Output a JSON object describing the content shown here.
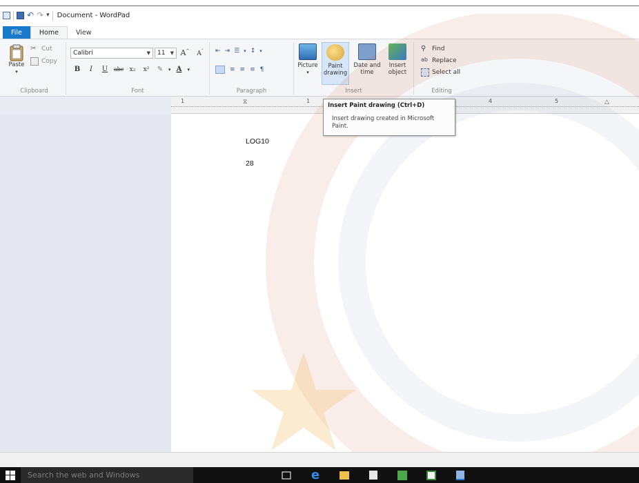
{
  "window": {
    "title": "Document - WordPad"
  },
  "tabs": [
    {
      "label": "File"
    },
    {
      "label": "Home"
    },
    {
      "label": "View"
    }
  ],
  "ribbon": {
    "clipboard": {
      "label": "Clipboard",
      "paste": "Paste",
      "cut": "Cut",
      "copy": "Copy"
    },
    "font": {
      "label": "Font",
      "family": "Calibri",
      "size": "11"
    },
    "paragraph": {
      "label": "Paragraph"
    },
    "insert": {
      "label": "Insert",
      "picture": "Picture",
      "paint_line1": "Paint",
      "paint_line2": "drawing",
      "datetime_line1": "Date and",
      "datetime_line2": "time",
      "object_line1": "Insert",
      "object_line2": "object"
    },
    "editing": {
      "label": "Editing",
      "find": "Find",
      "replace": "Replace",
      "select_all": "Select all"
    }
  },
  "ruler": {
    "numbers": [
      "1",
      "1",
      "4",
      "5"
    ]
  },
  "tooltip": {
    "title": "Insert Paint drawing (Ctrl+D)",
    "body": "Insert drawing created in Microsoft Paint."
  },
  "document": {
    "lines": [
      "LOG10",
      "28"
    ]
  },
  "taskbar": {
    "search_placeholder": "Search the web and Windows"
  },
  "colors": {
    "file_tab": "#1979ca",
    "taskbar": "#101010"
  }
}
